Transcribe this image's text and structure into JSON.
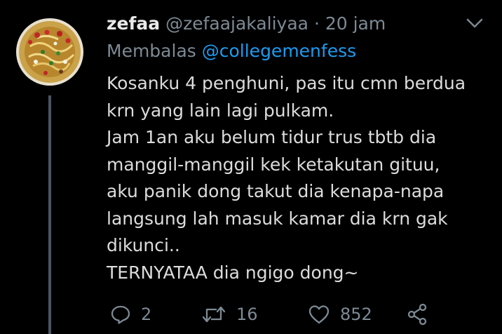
{
  "tweet": {
    "display_name": "zefaa",
    "handle": "@zefaajakaliyaa",
    "separator": "·",
    "time": "20 jam",
    "reply_label": "Membalas",
    "reply_to": "@collegemenfess",
    "body_lines": [
      "Kosanku 4 penghuni, pas itu cmn berdua",
      "krn yang lain lagi pulkam.",
      "Jam 1an aku belum tidur trus tbtb dia",
      "manggil-manggil kek ketakutan gituu,",
      "aku panik dong takut dia kenapa-napa",
      "langsung lah masuk kamar dia krn gak",
      "dikunci..",
      "TERNYATAA dia ngigo dong~"
    ]
  },
  "actions": {
    "reply": {
      "icon": "reply-icon",
      "count": "2"
    },
    "retweet": {
      "icon": "retweet-icon",
      "count": "16"
    },
    "like": {
      "icon": "heart-icon",
      "count": "852"
    },
    "share": {
      "icon": "share-icon"
    }
  },
  "colors": {
    "background": "#000000",
    "text": "#dcdcdc",
    "muted": "#7d8a94",
    "accent": "#1d9bf0",
    "thread_line": "#4a5560"
  }
}
